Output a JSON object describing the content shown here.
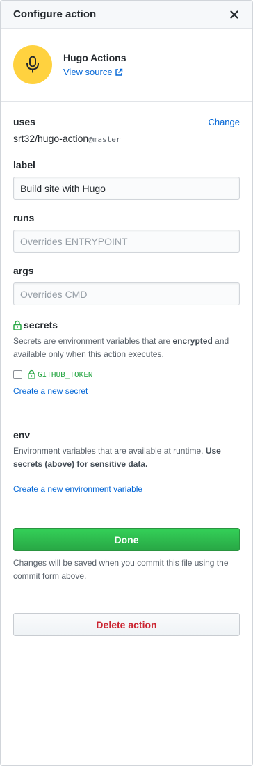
{
  "header": {
    "title": "Configure action",
    "close_icon": "close-icon"
  },
  "action": {
    "name": "Hugo Actions",
    "view_source": "View source",
    "avatar_icon": "microphone-icon",
    "avatar_color": "#ffd23f"
  },
  "uses": {
    "label": "uses",
    "change": "Change",
    "repo": "srt32/hugo-action",
    "ref": "@master"
  },
  "label_field": {
    "label": "label",
    "value": "Build site with Hugo",
    "placeholder": ""
  },
  "runs_field": {
    "label": "runs",
    "value": "",
    "placeholder": "Overrides ENTRYPOINT"
  },
  "args_field": {
    "label": "args",
    "value": "",
    "placeholder": "Overrides CMD"
  },
  "secrets": {
    "label": "secrets",
    "help_prefix": "Secrets are environment variables that are ",
    "help_bold": "encrypted",
    "help_suffix": " and available only when this action executes.",
    "items": [
      {
        "name": "GITHUB_TOKEN",
        "checked": false
      }
    ],
    "create_link": "Create a new secret"
  },
  "env": {
    "label": "env",
    "help_prefix": "Environment variables that are available at runtime. ",
    "help_bold": "Use secrets (above) for sensitive data.",
    "create_link": "Create a new environment variable"
  },
  "footer": {
    "done_label": "Done",
    "done_note": "Changes will be saved when you commit this file using the commit form above.",
    "delete_label": "Delete action"
  },
  "colors": {
    "link": "#0366d6",
    "primary_green": "#28a745",
    "danger_red": "#cb2431",
    "secret_green": "#28a745"
  }
}
